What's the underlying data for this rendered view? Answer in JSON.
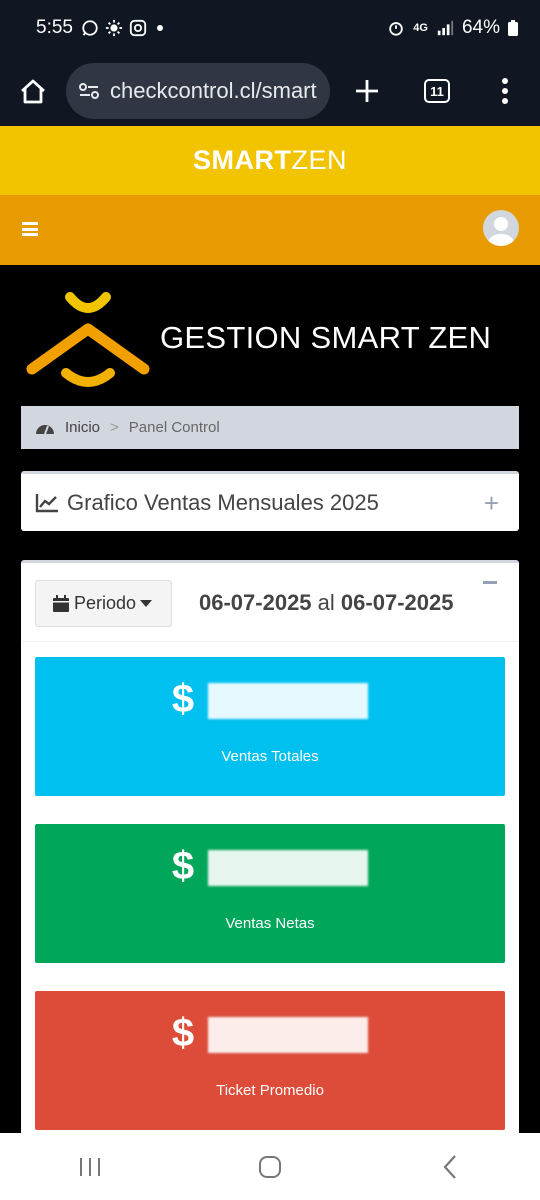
{
  "status_bar": {
    "time": "5:55",
    "network": "4G",
    "battery": "64%",
    "icons": [
      "whatsapp-icon",
      "brightness-icon",
      "instagram-icon",
      "alarm-icon",
      "signal-icon",
      "battery-icon"
    ]
  },
  "browser": {
    "url": "checkcontrol.cl/smart",
    "tab_count": "11"
  },
  "brand": {
    "bold": "SMART",
    "light": "ZEN",
    "colors": {
      "brand_bar": "#f2c400",
      "nav_bar": "#e89b00"
    }
  },
  "header": {
    "title": "GESTION SMART ZEN"
  },
  "breadcrumb": {
    "home": "Inicio",
    "separator": ">",
    "current": "Panel Control"
  },
  "chart_box": {
    "title": "Grafico Ventas Mensuales 2025",
    "toggle": "+"
  },
  "period_box": {
    "button_label": "Periodo",
    "date_from": "06-07-2025",
    "connector": "al",
    "date_to": "06-07-2025"
  },
  "stats": [
    {
      "currency": "$",
      "label": "Ventas Totales",
      "color": "#00c0ef"
    },
    {
      "currency": "$",
      "label": "Ventas Netas",
      "color": "#00a65a"
    },
    {
      "currency": "$",
      "label": "Ticket Promedio",
      "color": "#dd4b39"
    }
  ]
}
